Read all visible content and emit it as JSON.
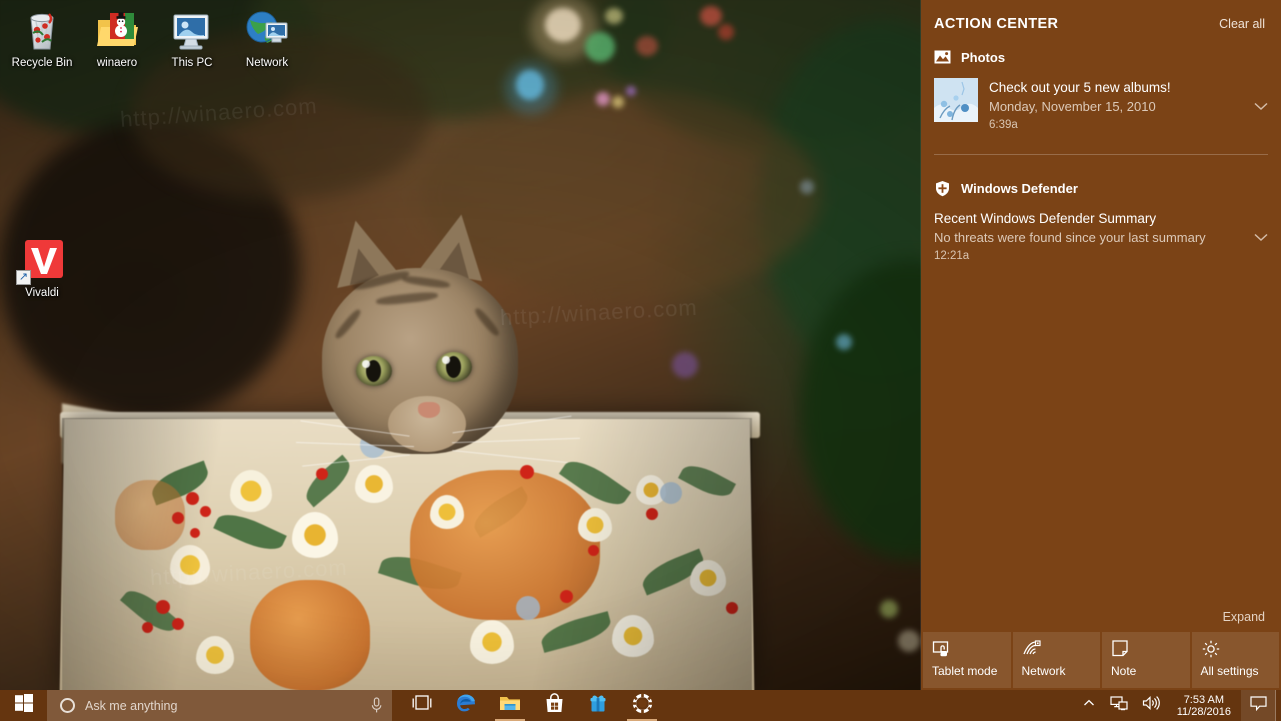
{
  "desktop": {
    "icons": [
      {
        "label": "Recycle Bin",
        "icon": "recycle-bin-icon",
        "shortcut": false
      },
      {
        "label": "winaero",
        "icon": "folder-winaero-icon",
        "shortcut": false
      },
      {
        "label": "This PC",
        "icon": "this-pc-icon",
        "shortcut": false
      },
      {
        "label": "Network",
        "icon": "network-icon",
        "shortcut": false
      },
      {
        "label": "Vivaldi",
        "icon": "vivaldi-icon",
        "shortcut": true
      }
    ]
  },
  "action_center": {
    "title": "ACTION CENTER",
    "clear_all_label": "Clear all",
    "expand_label": "Expand",
    "accent_color": "#844818",
    "groups": [
      {
        "name": "Photos",
        "icon": "photos-icon",
        "notifications": [
          {
            "title": "Check out your 5 new albums!",
            "subtitle": "Monday, November 15, 2010",
            "time": "6:39a",
            "thumbnail": "photo-thumbnail",
            "chevron": "chevron-down-icon"
          }
        ]
      },
      {
        "name": "Windows Defender",
        "icon": "shield-icon",
        "notifications": [
          {
            "title": "Recent Windows Defender Summary",
            "subtitle": "No threats were found since your last summary",
            "time": "12:21a",
            "thumbnail": null,
            "chevron": "chevron-down-icon"
          }
        ]
      }
    ],
    "quick_actions": [
      {
        "label": "Tablet mode",
        "icon": "tablet-mode-icon"
      },
      {
        "label": "Network",
        "icon": "network-wifi-icon"
      },
      {
        "label": "Note",
        "icon": "note-icon"
      },
      {
        "label": "All settings",
        "icon": "gear-icon"
      }
    ]
  },
  "taskbar": {
    "start_label": "Start",
    "start_icon": "windows-logo-icon",
    "search": {
      "placeholder": "Ask me anything",
      "cortana_icon": "cortana-circle-icon",
      "mic_icon": "microphone-icon"
    },
    "buttons": [
      {
        "name": "task-view",
        "icon": "task-view-icon",
        "open": false
      },
      {
        "name": "microsoft-edge",
        "icon": "edge-icon",
        "open": false
      },
      {
        "name": "file-explorer",
        "icon": "file-explorer-icon",
        "open": true
      },
      {
        "name": "microsoft-store",
        "icon": "store-icon",
        "open": false
      },
      {
        "name": "store-app",
        "icon": "store-app-icon",
        "open": false
      },
      {
        "name": "settings",
        "icon": "gear-icon",
        "open": true
      }
    ],
    "tray": {
      "overflow_icon": "chevron-up-icon",
      "network_icon": "network-monitor-icon",
      "volume_icon": "speaker-icon",
      "time": "7:53 AM",
      "date": "11/28/2016",
      "action_center_icon": "action-center-icon"
    }
  }
}
